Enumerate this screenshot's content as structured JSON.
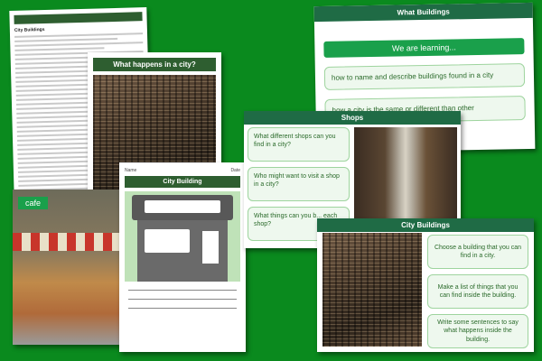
{
  "doc_card": {
    "brand": "",
    "title": "City Buildings"
  },
  "what_happens": {
    "title": "What happens in a city?"
  },
  "cafe_card": {
    "label": "cafe"
  },
  "building_sheet": {
    "name_label": "Name",
    "date_label": "Date",
    "title": "City Building"
  },
  "what_buildings": {
    "title": "What Buildings",
    "learning": "We are learning...",
    "objectives": [
      "how to name and describe buildings found in a city",
      "how a city is the same or different than other"
    ]
  },
  "shops": {
    "title": "Shops",
    "questions": [
      "What different shops can you find in a city?",
      "Who might want to visit a shop in a city?",
      "What things can you b... each shop?"
    ]
  },
  "city_buildings": {
    "title": "City Buildings",
    "tasks": [
      "Choose a building that you can find in a city.",
      "Make a list of things that you can find inside the building.",
      "Write some sentences to say what happens inside the building."
    ]
  },
  "colors": {
    "background": "#0a8a1e",
    "header_green": "#1f6b45",
    "accent_green": "#1aa04b",
    "pill_border": "#9ed49e"
  }
}
